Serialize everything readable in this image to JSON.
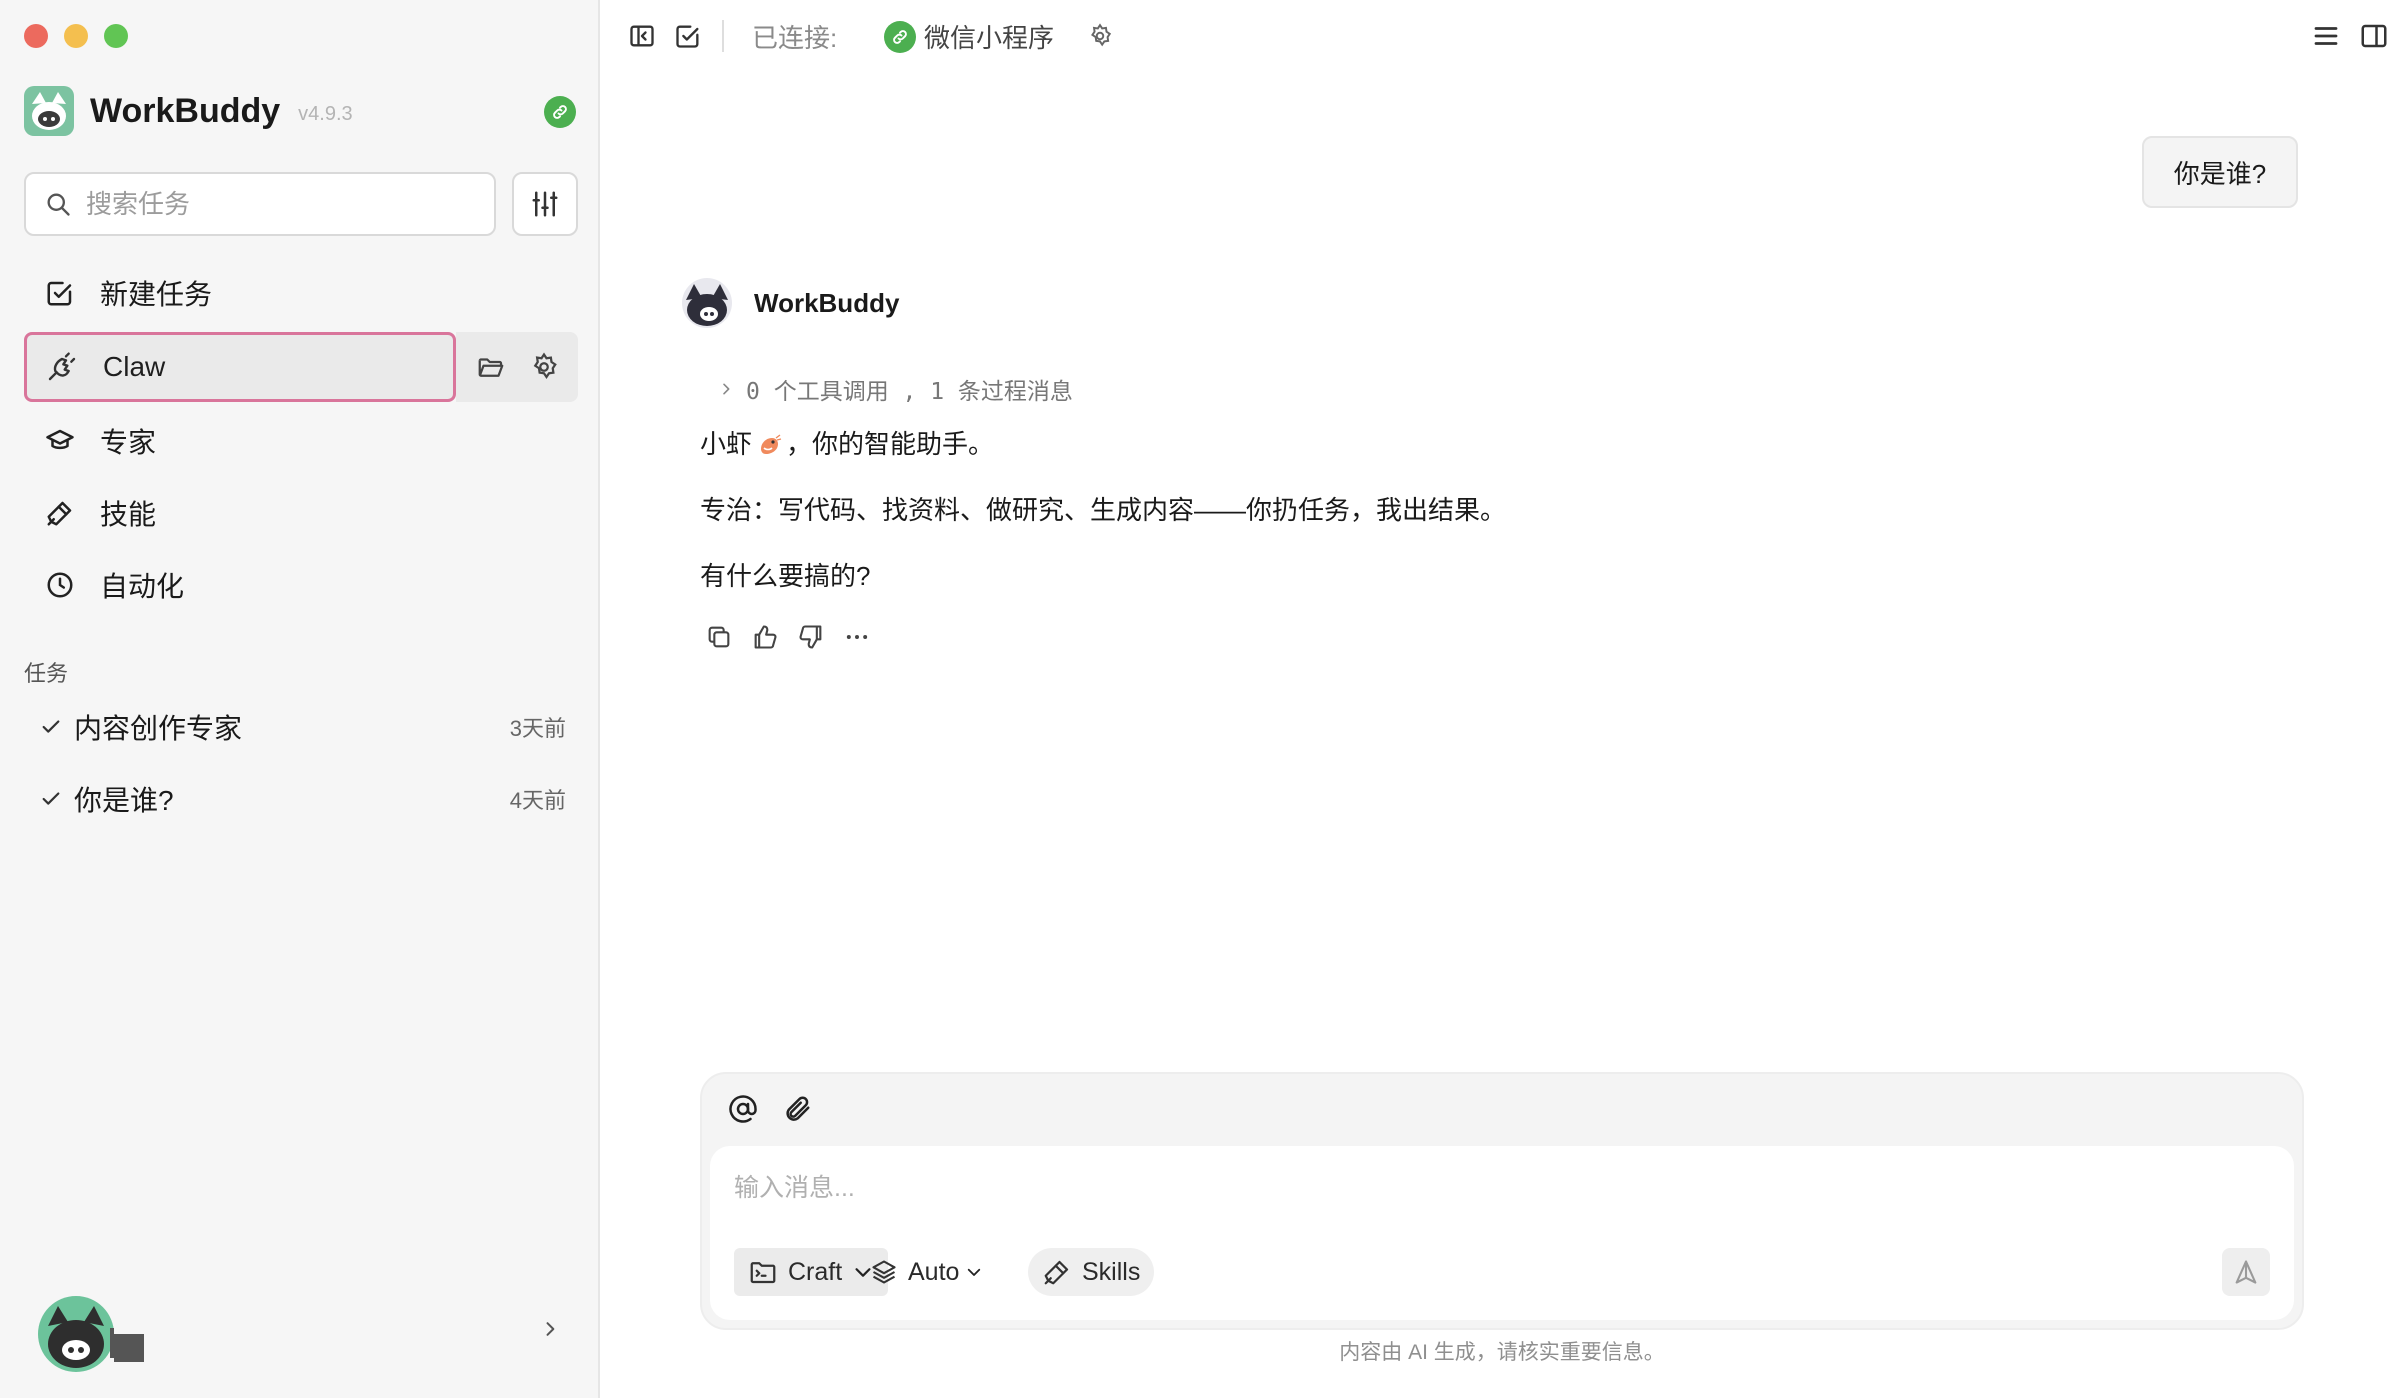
{
  "app": {
    "name": "WorkBuddy",
    "version": "v4.9.3"
  },
  "sidebar": {
    "search_placeholder": "搜索任务",
    "nav": {
      "new_task": "新建任务",
      "claw": "Claw",
      "experts": "专家",
      "skills": "技能",
      "automation": "自动化"
    },
    "tasks_title": "任务",
    "tasks": [
      {
        "title": "内容创作专家",
        "time": "3天前"
      },
      {
        "title": "你是谁?",
        "time": "4天前"
      }
    ]
  },
  "topbar": {
    "connected_label": "已连接:",
    "connection_name": "微信小程序"
  },
  "chat": {
    "user_message": "你是谁?",
    "bot_name": "WorkBuddy",
    "process_summary": "0 个工具调用 , 1 条过程消息",
    "reply": {
      "line1_prefix": "小虾",
      "line1_suffix": "，你的智能助手。",
      "line2": "专治：写代码、找资料、做研究、生成内容——你扔任务，我出结果。",
      "line3": "有什么要搞的?"
    }
  },
  "composer": {
    "placeholder": "输入消息...",
    "mode_label": "Craft",
    "model_label": "Auto",
    "skills_label": "Skills",
    "disclaimer": "内容由 AI 生成，请核实重要信息。"
  },
  "colors": {
    "accent_pink": "#d9759b",
    "brand_green": "#4caf50",
    "logo_teal": "#7cc3a1"
  }
}
